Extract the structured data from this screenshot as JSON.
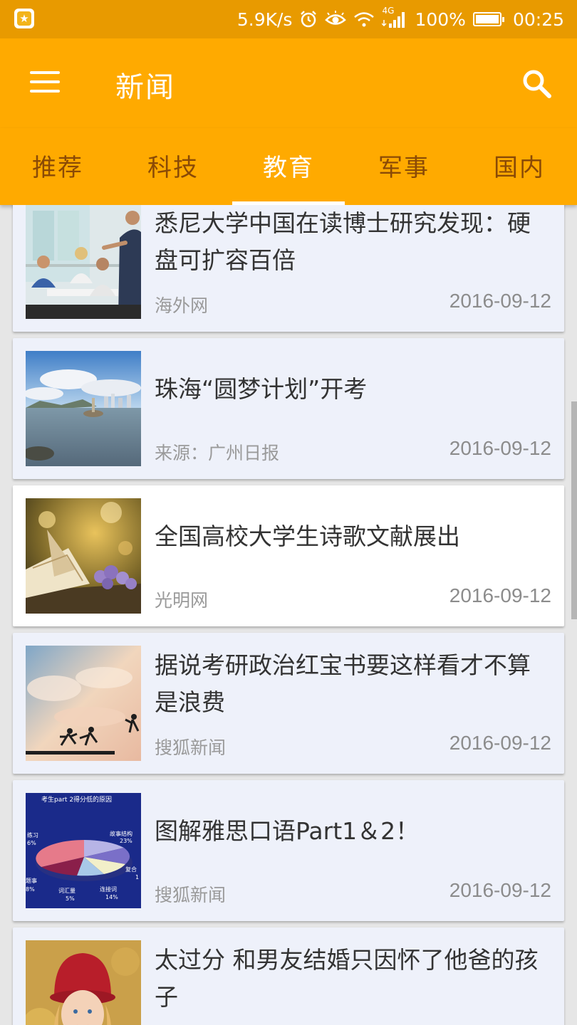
{
  "status_bar": {
    "network_speed": "5.9K/s",
    "network_type": "4G",
    "battery": "100%",
    "time": "00:25",
    "icons": [
      "app-notification-icon",
      "alarm-icon",
      "eye-icon",
      "wifi-icon",
      "signal-icon",
      "battery-icon"
    ]
  },
  "app_bar": {
    "title": "新闻",
    "menu_icon": "hamburger-menu-icon",
    "search_icon": "search-icon"
  },
  "tabs": [
    {
      "label": "推荐",
      "active": false
    },
    {
      "label": "科技",
      "active": false
    },
    {
      "label": "教育",
      "active": true
    },
    {
      "label": "军事",
      "active": false
    },
    {
      "label": "国内",
      "active": false
    }
  ],
  "news": [
    {
      "title": "悉尼大学中国在读博士研究发现：硬盘可扩容百倍",
      "source": "海外网",
      "date": "2016-09-12"
    },
    {
      "title": "珠海“圆梦计划”开考",
      "source": "来源：广州日报",
      "date": "2016-09-12"
    },
    {
      "title": "全国高校大学生诗歌文献展出",
      "source": "光明网",
      "date": "2016-09-12"
    },
    {
      "title": "据说考研政治红宝书要这样看才不算是浪费",
      "source": "搜狐新闻",
      "date": "2016-09-12"
    },
    {
      "title": "图解雅思口语Part1＆2！",
      "source": "搜狐新闻",
      "date": "2016-09-12",
      "thumbnail_text": {
        "title": "考生part 2得分低的原因",
        "label_story": "故事结构",
        "pct_story": "23%",
        "label_practice": "练习",
        "pct_practice": "6%",
        "label_fuhe": "复合",
        "pct_fuhe": "1",
        "label_topic": "题事",
        "pct_topic": "8%",
        "label_vocab": "词汇量",
        "pct_vocab": "5%",
        "label_conn": "连接词",
        "pct_conn": "14%"
      }
    },
    {
      "title": "太过分 和男友结婚只因怀了他爸的孩子",
      "source": "",
      "date": ""
    }
  ],
  "colors": {
    "status_bar": "#e89a00",
    "app_bar": "#ffaa00",
    "tab_inactive_text": "#8a4a06",
    "tab_active_text": "#ffffff",
    "card_background": "#eef1fa",
    "card_pressed_background": "#ffffff"
  }
}
